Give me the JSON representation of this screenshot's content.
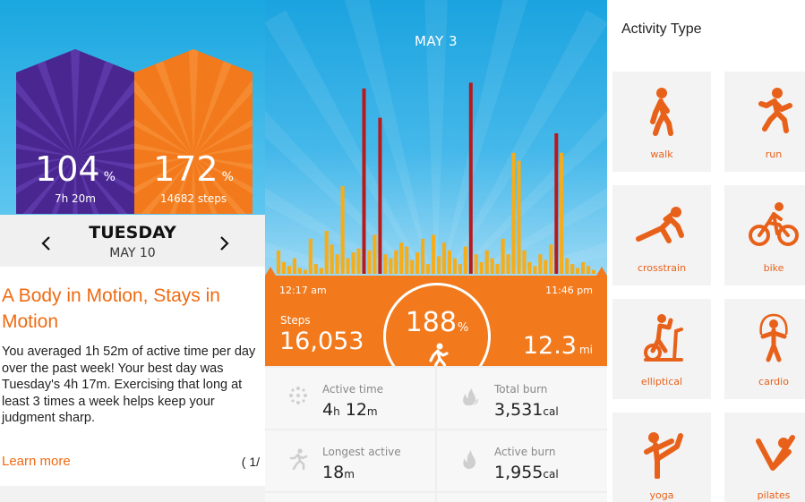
{
  "colors": {
    "accent_orange": "#f27a1d",
    "purple": "#4b2a93",
    "sky_blue": "#1ba3df",
    "bar_yellow": "#f5ad1c",
    "bar_red": "#b8191a"
  },
  "panel_summary": {
    "goals": [
      {
        "percent": "104",
        "unit": "%",
        "subtitle": "7h 20m"
      },
      {
        "percent": "172",
        "unit": "%",
        "subtitle": "14682 steps"
      }
    ],
    "day_name": "TUESDAY",
    "day_date": "MAY 10",
    "prev_icon": "chevron-left-icon",
    "next_icon": "chevron-right-icon",
    "headline": "A Body in Motion, Stays in Motion",
    "paragraph": "You averaged 1h 52m of active time per day over the past week! Your best day was Tuesday's 4h 17m. Exercising that long at least 3 times a week helps keep your judgment sharp.",
    "learn_more": "Learn more",
    "pager": "( 1/"
  },
  "panel_day": {
    "title": "MAY 3",
    "time_start": "12:17 am",
    "time_end": "11:46 pm",
    "steps_label": "Steps",
    "steps_value": "16,053",
    "goal_percent": "188",
    "goal_unit": "%",
    "distance_value": "12.3",
    "distance_unit": "mi",
    "tiles": [
      {
        "label": "Active time",
        "value_a": "4",
        "unit_a": "h",
        "value_b": " 12",
        "unit_b": "m",
        "icon": "burst-icon"
      },
      {
        "label": "Total burn",
        "value_a": "3,531",
        "unit_a": "cal",
        "value_b": "",
        "unit_b": "",
        "icon": "flames-icon"
      },
      {
        "label": "Longest active",
        "value_a": "18",
        "unit_a": "m",
        "value_b": "",
        "unit_b": "",
        "icon": "runner-icon"
      },
      {
        "label": "Active burn",
        "value_a": "1,955",
        "unit_a": "cal",
        "value_b": "",
        "unit_b": "",
        "icon": "flame-icon"
      }
    ],
    "step_bars": [
      {
        "v": 0.12,
        "c": "y"
      },
      {
        "v": 0.06,
        "c": "y"
      },
      {
        "v": 0.04,
        "c": "y"
      },
      {
        "v": 0.08,
        "c": "y"
      },
      {
        "v": 0.03,
        "c": "y"
      },
      {
        "v": 0.02,
        "c": "y"
      },
      {
        "v": 0.18,
        "c": "y"
      },
      {
        "v": 0.05,
        "c": "y"
      },
      {
        "v": 0.03,
        "c": "y"
      },
      {
        "v": 0.22,
        "c": "y"
      },
      {
        "v": 0.15,
        "c": "y"
      },
      {
        "v": 0.1,
        "c": "y"
      },
      {
        "v": 0.45,
        "c": "y"
      },
      {
        "v": 0.08,
        "c": "y"
      },
      {
        "v": 0.11,
        "c": "y"
      },
      {
        "v": 0.13,
        "c": "y"
      },
      {
        "v": 0.95,
        "c": "r"
      },
      {
        "v": 0.12,
        "c": "y"
      },
      {
        "v": 0.2,
        "c": "y"
      },
      {
        "v": 0.8,
        "c": "r"
      },
      {
        "v": 0.1,
        "c": "y"
      },
      {
        "v": 0.08,
        "c": "y"
      },
      {
        "v": 0.12,
        "c": "y"
      },
      {
        "v": 0.16,
        "c": "y"
      },
      {
        "v": 0.14,
        "c": "y"
      },
      {
        "v": 0.07,
        "c": "y"
      },
      {
        "v": 0.11,
        "c": "y"
      },
      {
        "v": 0.18,
        "c": "y"
      },
      {
        "v": 0.05,
        "c": "y"
      },
      {
        "v": 0.2,
        "c": "y"
      },
      {
        "v": 0.09,
        "c": "y"
      },
      {
        "v": 0.16,
        "c": "y"
      },
      {
        "v": 0.12,
        "c": "y"
      },
      {
        "v": 0.08,
        "c": "y"
      },
      {
        "v": 0.05,
        "c": "y"
      },
      {
        "v": 0.14,
        "c": "y"
      },
      {
        "v": 0.98,
        "c": "r"
      },
      {
        "v": 0.1,
        "c": "y"
      },
      {
        "v": 0.06,
        "c": "y"
      },
      {
        "v": 0.12,
        "c": "y"
      },
      {
        "v": 0.08,
        "c": "y"
      },
      {
        "v": 0.05,
        "c": "y"
      },
      {
        "v": 0.18,
        "c": "y"
      },
      {
        "v": 0.1,
        "c": "y"
      },
      {
        "v": 0.62,
        "c": "y"
      },
      {
        "v": 0.58,
        "c": "y"
      },
      {
        "v": 0.12,
        "c": "y"
      },
      {
        "v": 0.06,
        "c": "y"
      },
      {
        "v": 0.04,
        "c": "y"
      },
      {
        "v": 0.1,
        "c": "y"
      },
      {
        "v": 0.07,
        "c": "y"
      },
      {
        "v": 0.15,
        "c": "y"
      },
      {
        "v": 0.72,
        "c": "r"
      },
      {
        "v": 0.62,
        "c": "y"
      },
      {
        "v": 0.08,
        "c": "y"
      },
      {
        "v": 0.05,
        "c": "y"
      },
      {
        "v": 0.03,
        "c": "y"
      },
      {
        "v": 0.06,
        "c": "y"
      },
      {
        "v": 0.04,
        "c": "y"
      },
      {
        "v": 0.02,
        "c": "y"
      }
    ]
  },
  "panel_activity": {
    "title": "Activity Type",
    "items": [
      {
        "label": "walk",
        "icon": "walk-icon"
      },
      {
        "label": "run",
        "icon": "run-icon"
      },
      {
        "label": "crosstrain",
        "icon": "crosstrain-icon"
      },
      {
        "label": "bike",
        "icon": "bike-icon"
      },
      {
        "label": "elliptical",
        "icon": "elliptical-icon"
      },
      {
        "label": "cardio",
        "icon": "cardio-icon"
      },
      {
        "label": "yoga",
        "icon": "yoga-icon"
      },
      {
        "label": "pilates",
        "icon": "pilates-icon"
      }
    ]
  }
}
